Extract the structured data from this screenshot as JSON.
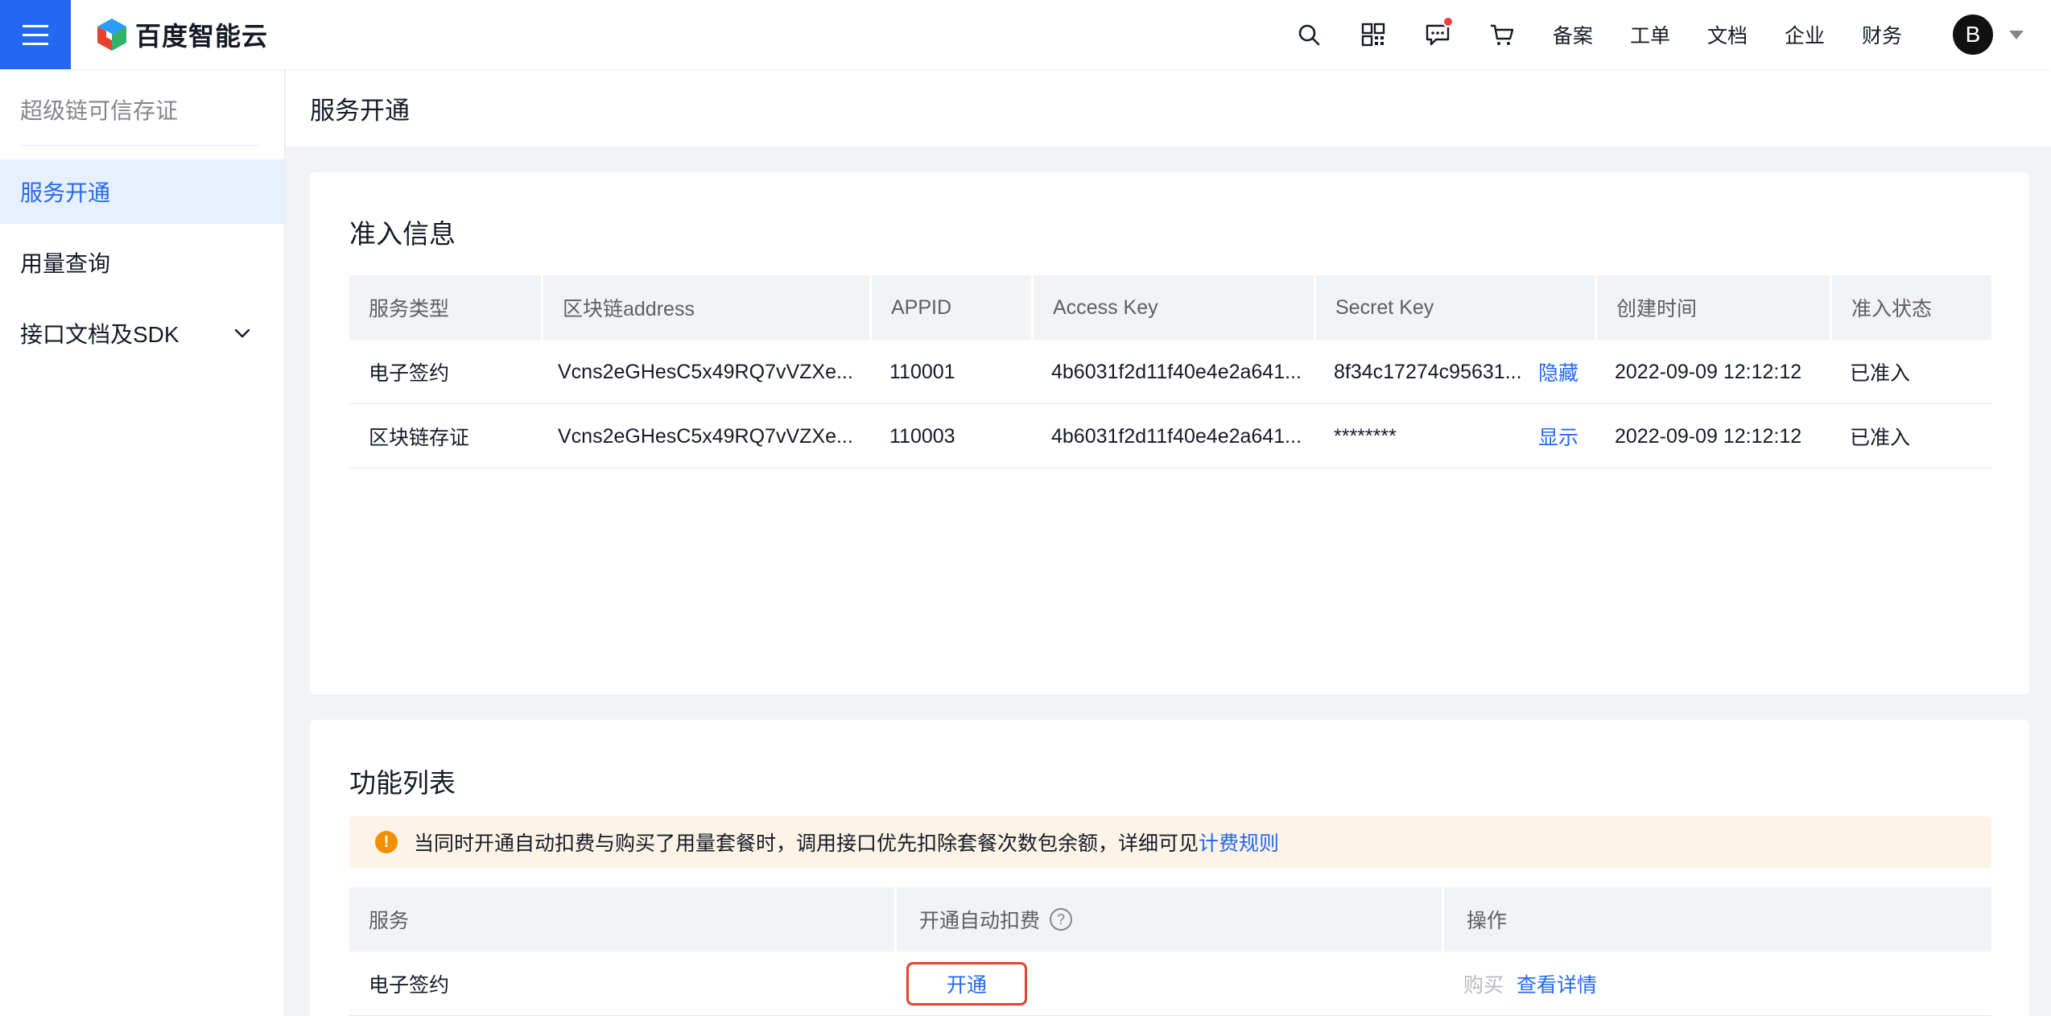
{
  "brand": {
    "name": "百度智能云"
  },
  "topnav": {
    "links": [
      "备案",
      "工单",
      "文档",
      "企业",
      "财务"
    ],
    "avatar_initial": "B"
  },
  "sidebar": {
    "title": "超级链可信存证",
    "items": [
      {
        "label": "服务开通",
        "active": true
      },
      {
        "label": "用量查询",
        "active": false
      },
      {
        "label": "接口文档及SDK",
        "active": false,
        "expandable": true
      }
    ]
  },
  "page": {
    "title": "服务开通"
  },
  "access_info": {
    "title": "准入信息",
    "columns": [
      "服务类型",
      "区块链address",
      "APPID",
      "Access Key",
      "Secret Key",
      "创建时间",
      "准入状态"
    ],
    "rows": [
      {
        "service_type": "电子签约",
        "address": "Vcns2eGHesC5x49RQ7vVZXe...",
        "appid": "110001",
        "access_key": "4b6031f2d11f40e4e2a641...",
        "secret_key": "8f34c17274c95631...",
        "secret_action": "隐藏",
        "created": "2022-09-09 12:12:12",
        "status": "已准入"
      },
      {
        "service_type": "区块链存证",
        "address": "Vcns2eGHesC5x49RQ7vVZXe...",
        "appid": "110003",
        "access_key": "4b6031f2d11f40e4e2a641...",
        "secret_key": "********",
        "secret_action": "显示",
        "created": "2022-09-09 12:12:12",
        "status": "已准入"
      }
    ]
  },
  "feature_list": {
    "title": "功能列表",
    "notice": {
      "text": "当同时开通自动扣费与购买了用量套餐时，调用接口优先扣除套餐次数包余额，详细可见",
      "link": "计费规则"
    },
    "columns": [
      "服务",
      "开通自动扣费",
      "操作"
    ],
    "rows": [
      {
        "service": "电子签约",
        "auto_pay_action": "开通",
        "buy_label": "购买",
        "details_label": "查看详情"
      }
    ]
  },
  "colors": {
    "primary": "#2468f2",
    "highlight_border": "#e5432d",
    "notice_bg": "#fdf3e6",
    "warning": "#f39000"
  }
}
